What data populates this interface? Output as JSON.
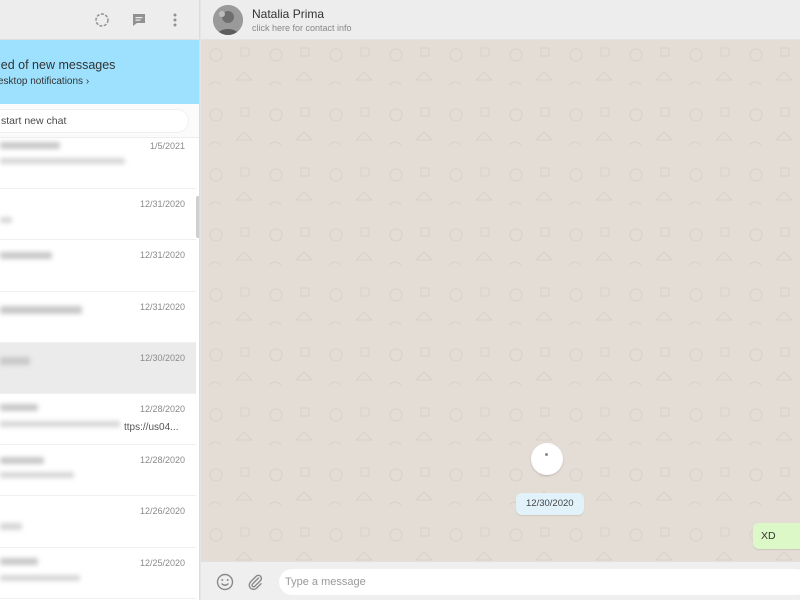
{
  "notification": {
    "title": "ied of new messages",
    "link": "esktop notifications ›"
  },
  "search": {
    "placeholder": "start new chat"
  },
  "chat_list": [
    {
      "date": "1/5/2021",
      "preview": ""
    },
    {
      "date": "12/31/2020",
      "preview": ""
    },
    {
      "date": "12/31/2020",
      "preview": ""
    },
    {
      "date": "12/31/2020",
      "preview": ""
    },
    {
      "date": "12/30/2020",
      "preview": "",
      "active": true
    },
    {
      "date": "12/28/2020",
      "preview": "ttps://us04..."
    },
    {
      "date": "12/28/2020",
      "preview": ""
    },
    {
      "date": "12/26/2020",
      "preview": ""
    },
    {
      "date": "12/25/2020",
      "preview": ""
    }
  ],
  "contact": {
    "name": "Natalia Prima",
    "subtitle": "click here for contact info"
  },
  "conversation": {
    "date_divider": "12/30/2020",
    "messages": [
      {
        "text": "XD",
        "direction": "outgoing"
      }
    ]
  },
  "composer": {
    "placeholder": "Type a message"
  },
  "icons": {
    "status": "status-icon",
    "new_chat": "new-chat-icon",
    "menu": "menu-icon",
    "emoji": "emoji-icon",
    "attach": "attach-icon"
  },
  "colors": {
    "notification_bg": "#9de1fe",
    "conversation_bg": "#e4ddd5",
    "outgoing_bubble": "#dcf8c6",
    "date_pill": "#e1f2fb"
  }
}
